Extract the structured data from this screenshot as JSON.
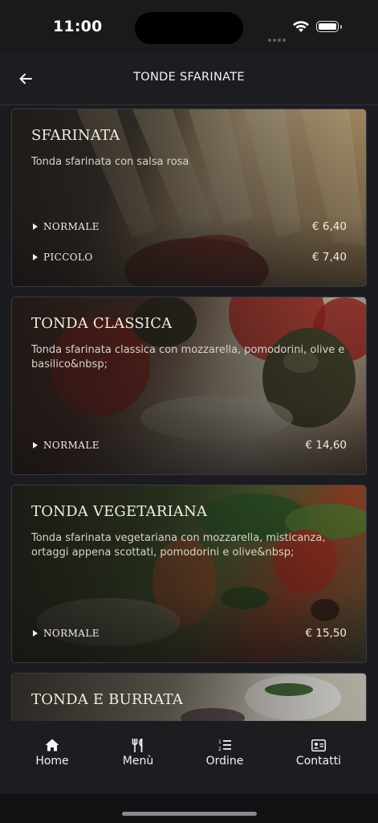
{
  "status_bar": {
    "time": "11:00"
  },
  "header": {
    "title": "TONDE SFARINATE"
  },
  "items": [
    {
      "name": "SFARINATA",
      "description": "Tonda sfarinata con salsa rosa",
      "sizes": [
        {
          "label": "NORMALE",
          "price": "€ 6,40"
        },
        {
          "label": "PICCOLO",
          "price": "€ 7,40"
        }
      ]
    },
    {
      "name": "TONDA CLASSICA",
      "description": "Tonda sfarinata classica con mozzarella, pomodorini, olive e basilico&nbsp;",
      "sizes": [
        {
          "label": "NORMALE",
          "price": "€ 14,60"
        }
      ]
    },
    {
      "name": "TONDA VEGETARIANA",
      "description": "Tonda sfarinata vegetariana con mozzarella, misticanza, ortaggi appena scottati, pomodorini e olive&nbsp;",
      "sizes": [
        {
          "label": "NORMALE",
          "price": "€ 15,50"
        }
      ]
    },
    {
      "name": "TONDA E BURRATA"
    }
  ],
  "tabbar": {
    "tabs": [
      {
        "label": "Home",
        "icon": "home-icon"
      },
      {
        "label": "Menù",
        "icon": "fork-knife-icon"
      },
      {
        "label": "Ordine",
        "icon": "numbered-list-icon"
      },
      {
        "label": "Contatti",
        "icon": "contact-card-icon"
      }
    ]
  },
  "colors": {
    "background": "#1c1c20",
    "text": "#f2efe6",
    "card_border": "#3a3a40"
  }
}
